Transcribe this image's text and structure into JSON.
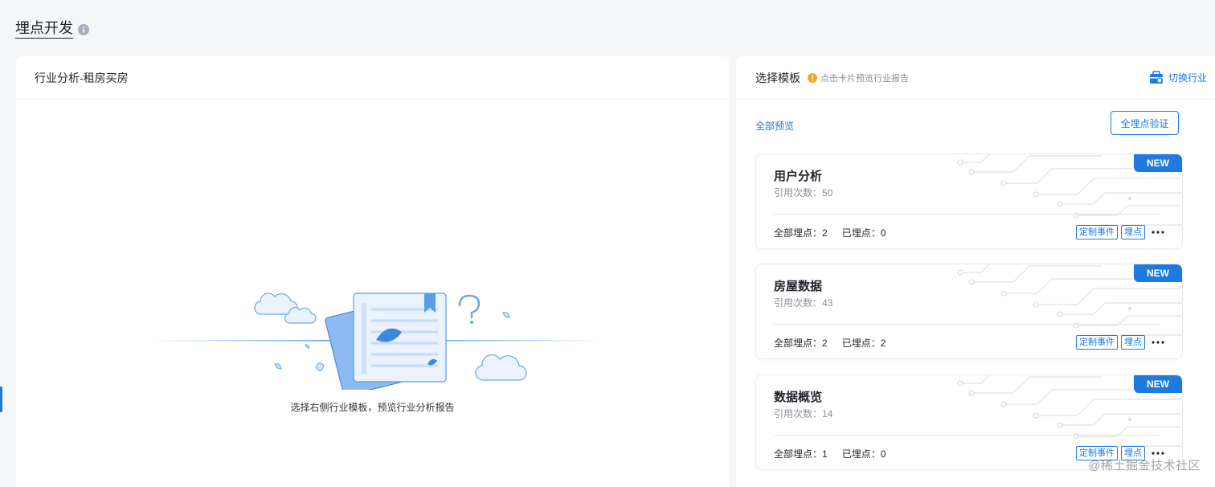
{
  "page": {
    "title": "埋点开发"
  },
  "left_panel": {
    "title": "行业分析-租房买房",
    "empty_text": "选择右侧行业模板，预览行业分析报告"
  },
  "right_panel": {
    "title": "选择模板",
    "hint": "点击卡片预览行业报告",
    "switch_label": "切换行业",
    "preview_all": "全部预览",
    "verify_all": "全埋点验证",
    "cards": [
      {
        "title": "用户分析",
        "usage_label": "引用次数：50",
        "badge": "NEW",
        "total_label": "全部埋点：2",
        "done_label": "已埋点：0",
        "tag_custom": "定制事件",
        "tag_point": "埋点"
      },
      {
        "title": "房屋数据",
        "usage_label": "引用次数：43",
        "badge": "NEW",
        "total_label": "全部埋点：2",
        "done_label": "已埋点：2",
        "tag_custom": "定制事件",
        "tag_point": "埋点"
      },
      {
        "title": "数据概览",
        "usage_label": "引用次数：14",
        "badge": "NEW",
        "total_label": "全部埋点：1",
        "done_label": "已埋点：0",
        "tag_custom": "定制事件",
        "tag_point": "埋点"
      }
    ]
  },
  "watermark": "@稀土掘金技术社区",
  "colors": {
    "accent": "#1f7ae0",
    "hint": "#f5a623",
    "background": "#f5f6f7"
  }
}
